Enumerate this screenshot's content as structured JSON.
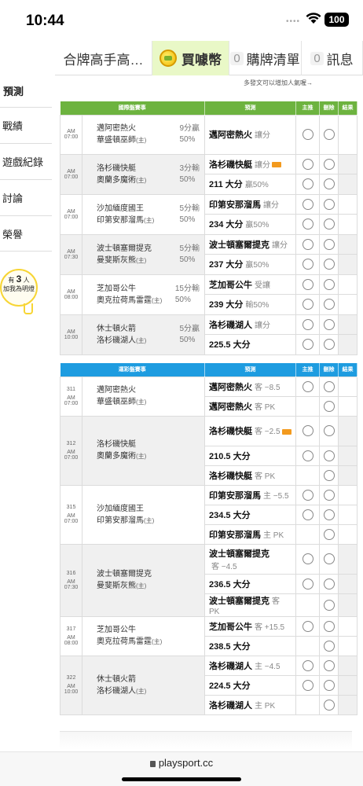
{
  "statusbar": {
    "time": "10:44",
    "battery": "100"
  },
  "topnav": {
    "tab1": "合牌高手高…",
    "tab2": "買噱幣",
    "tab3_count": "0",
    "tab3": "購牌清單",
    "tab4_count": "0",
    "tab4": "訊息"
  },
  "sidebar": {
    "title": "預測",
    "items": [
      "戰績",
      "遊戲紀錄",
      "討論",
      "榮譽"
    ],
    "bulb": {
      "prefix": "有",
      "count": "3",
      "suffix": "人",
      "text": "加我為明燈"
    }
  },
  "hint": "多發文可以增加人氣喔→",
  "table1": {
    "headers": [
      "國際盤賽事",
      "預測",
      "主推",
      "刪除",
      "結果"
    ],
    "games": [
      {
        "time": "AM 07:00",
        "away": "邁阿密熱火",
        "home": "華盛頓巫師",
        "home_tag": "(主)",
        "spread1": "9分贏",
        "spread2": "50%",
        "preds": [
          {
            "main": "邁阿密熱火",
            "sub": "讓分",
            "badge": false
          }
        ]
      },
      {
        "time": "AM 07:00",
        "away": "洛杉磯快艇",
        "home": "奧蘭多魔術",
        "home_tag": "(主)",
        "spread1": "3分輸",
        "spread2": "50%",
        "preds": [
          {
            "main": "洛杉磯快艇",
            "sub": "讓分",
            "badge": true
          },
          {
            "main": "211 大分",
            "sub": "贏50%",
            "badge": false
          }
        ]
      },
      {
        "time": "AM 07:00",
        "away": "沙加緬度國王",
        "home": "印第安那溜馬",
        "home_tag": "(主)",
        "spread1": "5分輸",
        "spread2": "50%",
        "preds": [
          {
            "main": "印第安那溜馬",
            "sub": "讓分",
            "badge": false
          },
          {
            "main": "234 大分",
            "sub": "贏50%",
            "badge": false
          }
        ]
      },
      {
        "time": "AM 07:30",
        "away": "波士頓塞爾提克",
        "home": "曼斐斯灰熊",
        "home_tag": "(主)",
        "spread1": "5分輸",
        "spread2": "50%",
        "preds": [
          {
            "main": "波士頓塞爾提克",
            "sub": "讓分",
            "badge": false
          },
          {
            "main": "237 大分",
            "sub": "贏50%",
            "badge": false
          }
        ]
      },
      {
        "time": "AM 08:00",
        "away": "芝加哥公牛",
        "home": "奧克拉荷馬雷霆",
        "home_tag": "(主)",
        "spread1": "15分輸",
        "spread2": "50%",
        "preds": [
          {
            "main": "芝加哥公牛",
            "sub": "受讓",
            "badge": false
          },
          {
            "main": "239 大分",
            "sub": "輸50%",
            "badge": false
          }
        ]
      },
      {
        "time": "AM 10:00",
        "away": "休士頓火箭",
        "home": "洛杉磯湖人",
        "home_tag": "(主)",
        "spread1": "5分贏",
        "spread2": "50%",
        "preds": [
          {
            "main": "洛杉磯湖人",
            "sub": "讓分",
            "badge": false
          },
          {
            "main": "225.5 大分",
            "sub": "",
            "badge": false
          }
        ]
      }
    ]
  },
  "table2": {
    "headers": [
      "運彩盤賽事",
      "預測",
      "主推",
      "刪除",
      "結果"
    ],
    "games": [
      {
        "gno": "311",
        "time": "AM 07:00",
        "away": "邁阿密熱火",
        "home": "華盛頓巫師",
        "home_tag": "(主)",
        "preds": [
          {
            "main": "邁阿密熱火",
            "sub": "客 −8.5",
            "badge": false,
            "main_radio": true
          },
          {
            "main": "邁阿密熱火",
            "sub": "客 PK",
            "badge": false,
            "main_radio": false
          }
        ]
      },
      {
        "gno": "312",
        "time": "AM 07:00",
        "away": "洛杉磯快艇",
        "home": "奧蘭多魔術",
        "home_tag": "(主)",
        "preds": [
          {
            "main": "洛杉磯快艇",
            "sub": "客 −2.5",
            "badge": true,
            "main_radio": true
          },
          {
            "main": "210.5 大分",
            "sub": "",
            "badge": false,
            "main_radio": true
          },
          {
            "main": "洛杉磯快艇",
            "sub": "客 PK",
            "badge": false,
            "main_radio": false
          }
        ]
      },
      {
        "gno": "315",
        "time": "AM 07:00",
        "away": "沙加緬度國王",
        "home": "印第安那溜馬",
        "home_tag": "(主)",
        "preds": [
          {
            "main": "印第安那溜馬",
            "sub": "主 −5.5",
            "badge": false,
            "main_radio": true
          },
          {
            "main": "234.5 大分",
            "sub": "",
            "badge": false,
            "main_radio": true
          },
          {
            "main": "印第安那溜馬",
            "sub": "主 PK",
            "badge": false,
            "main_radio": false
          }
        ]
      },
      {
        "gno": "316",
        "time": "AM 07:30",
        "away": "波士頓塞爾提克",
        "home": "曼斐斯灰熊",
        "home_tag": "(主)",
        "preds": [
          {
            "main": "波士頓塞爾提克",
            "sub": "客 −4.5",
            "badge": false,
            "main_radio": true,
            "wrap": true
          },
          {
            "main": "236.5 大分",
            "sub": "",
            "badge": false,
            "main_radio": true
          },
          {
            "main": "波士頓塞爾提克",
            "sub": "客 PK",
            "badge": false,
            "main_radio": false
          }
        ]
      },
      {
        "gno": "317",
        "time": "AM 08:00",
        "away": "芝加哥公牛",
        "home": "奧克拉荷馬雷霆",
        "home_tag": "(主)",
        "preds": [
          {
            "main": "芝加哥公牛",
            "sub": "客 +15.5",
            "badge": false,
            "main_radio": true
          },
          {
            "main": "238.5 大分",
            "sub": "",
            "badge": false,
            "main_radio": false
          }
        ]
      },
      {
        "gno": "322",
        "time": "AM 10:00",
        "away": "休士頓火箭",
        "home": "洛杉磯湖人",
        "home_tag": "(主)",
        "preds": [
          {
            "main": "洛杉磯湖人",
            "sub": "主 −4.5",
            "badge": false,
            "main_radio": true
          },
          {
            "main": "224.5 大分",
            "sub": "",
            "badge": false,
            "main_radio": true
          },
          {
            "main": "洛杉磯湖人",
            "sub": "主 PK",
            "badge": false,
            "main_radio": false
          }
        ]
      }
    ]
  },
  "browser": {
    "url": "playsport.cc"
  }
}
